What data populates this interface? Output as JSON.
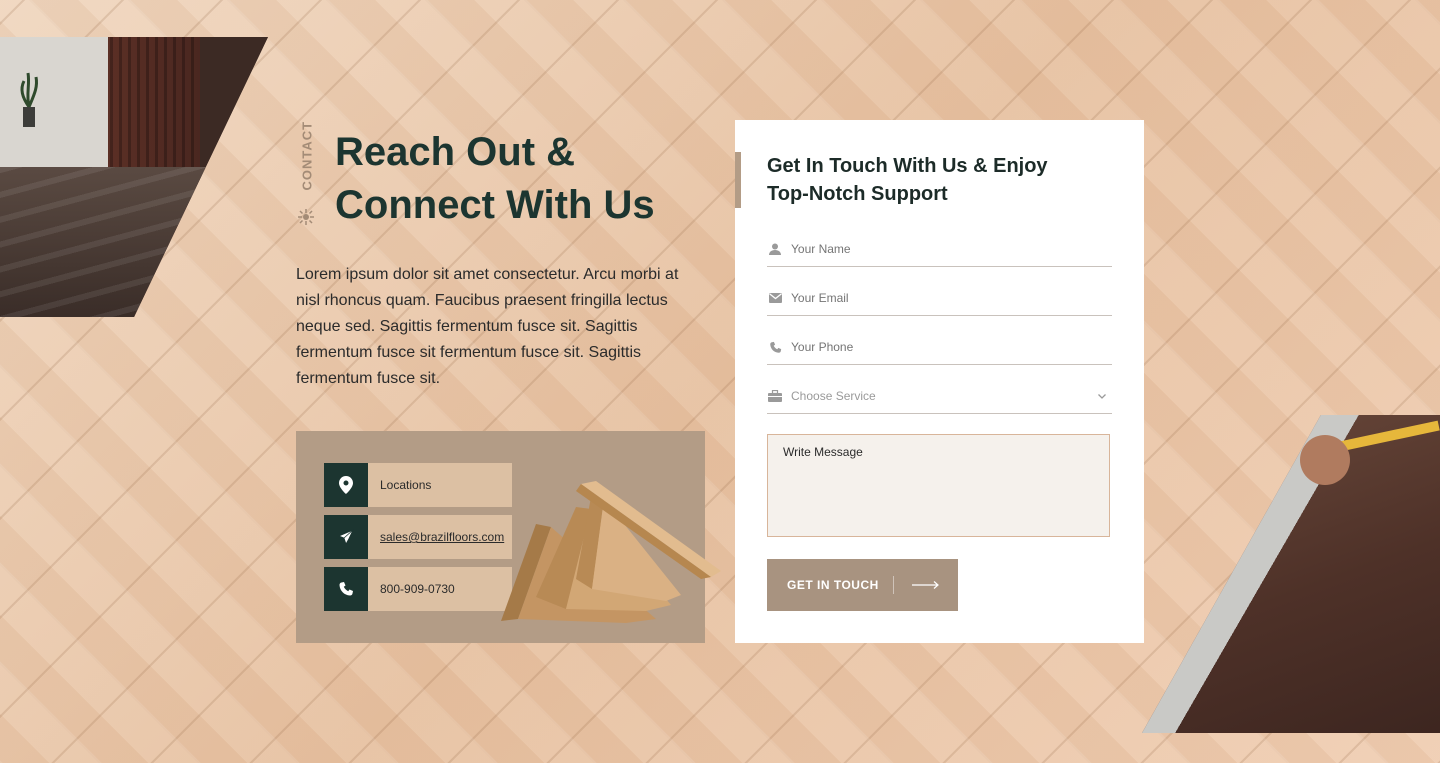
{
  "section": {
    "side_label": "CONTACT",
    "heading_line1": "Reach Out &",
    "heading_line2": "Connect With Us",
    "intro": "Lorem ipsum dolor sit amet consectetur. Arcu morbi at nisl rhoncus quam. Faucibus praesent fringilla lectus neque sed. Sagittis fermentum fusce sit. Sagittis fermentum fusce sit fermentum fusce sit. Sagittis fermentum fusce sit."
  },
  "contact_info": [
    {
      "icon": "location-pin-icon",
      "text": "Locations"
    },
    {
      "icon": "paper-plane-icon",
      "text": "sales@brazilfloors.com"
    },
    {
      "icon": "phone-icon",
      "text": "800-909-0730"
    }
  ],
  "form": {
    "title_line1": "Get In Touch With Us & Enjoy",
    "title_line2": "Top-Notch Support",
    "name_placeholder": "Your Name",
    "email_placeholder": "Your Email",
    "phone_placeholder": "Your Phone",
    "service_placeholder": "Choose Service",
    "message_placeholder": "Write Message",
    "submit_label": "GET IN TOUCH"
  },
  "colors": {
    "dark_green": "#1c3530",
    "accent_tan": "#b39c86",
    "button": "#a89380"
  }
}
